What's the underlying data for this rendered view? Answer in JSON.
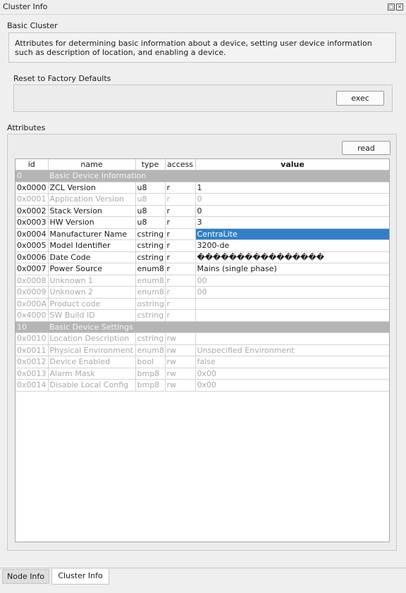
{
  "window": {
    "title": "Cluster Info"
  },
  "cluster": {
    "name": "Basic Cluster",
    "description": "Attributes for determining basic information about a device, setting user device information such as description of location, and enabling a device."
  },
  "reset": {
    "label": "Reset to Factory Defaults",
    "button": "exec"
  },
  "attributes": {
    "label": "Attributes",
    "read_button": "read",
    "columns": [
      "id",
      "name",
      "type",
      "access",
      "value"
    ],
    "rows": [
      {
        "kind": "group",
        "id": "0",
        "name": "Basic Device Information"
      },
      {
        "kind": "normal",
        "id": "0x0000",
        "name": "ZCL Version",
        "type": "u8",
        "access": "r",
        "value": "1"
      },
      {
        "kind": "disabled",
        "id": "0x0001",
        "name": "Application Version",
        "type": "u8",
        "access": "r",
        "value": "0"
      },
      {
        "kind": "normal",
        "id": "0x0002",
        "name": "Stack Version",
        "type": "u8",
        "access": "r",
        "value": "0"
      },
      {
        "kind": "normal",
        "id": "0x0003",
        "name": "HW Version",
        "type": "u8",
        "access": "r",
        "value": "3"
      },
      {
        "kind": "normal",
        "id": "0x0004",
        "name": "Manufacturer Name",
        "type": "cstring",
        "access": "r",
        "value": "CentraLite",
        "selected": true
      },
      {
        "kind": "normal",
        "id": "0x0005",
        "name": "Model Identifier",
        "type": "cstring",
        "access": "r",
        "value": "3200-de"
      },
      {
        "kind": "normal",
        "id": "0x0006",
        "name": "Date Code",
        "type": "cstring",
        "access": "r",
        "value": "����������������"
      },
      {
        "kind": "normal",
        "id": "0x0007",
        "name": "Power Source",
        "type": "enum8",
        "access": "r",
        "value": "Mains (single phase)"
      },
      {
        "kind": "disabled",
        "id": "0x0008",
        "name": "Unknown 1",
        "type": "enum8",
        "access": "r",
        "value": "00"
      },
      {
        "kind": "disabled",
        "id": "0x0009",
        "name": "Unknown 2",
        "type": "enum8",
        "access": "r",
        "value": "00"
      },
      {
        "kind": "disabled",
        "id": "0x000A",
        "name": "Product code",
        "type": "ostring",
        "access": "r",
        "value": ""
      },
      {
        "kind": "disabled",
        "id": "0x4000",
        "name": "SW Build ID",
        "type": "cstring",
        "access": "r",
        "value": ""
      },
      {
        "kind": "group",
        "id": "10",
        "name": "Basic Device Settings"
      },
      {
        "kind": "disabled",
        "id": "0x0010",
        "name": "Location Description",
        "type": "cstring",
        "access": "rw",
        "value": ""
      },
      {
        "kind": "disabled",
        "id": "0x0011",
        "name": "Physical Environment",
        "type": "enum8",
        "access": "rw",
        "value": "Unspecified Environment"
      },
      {
        "kind": "disabled",
        "id": "0x0012",
        "name": "Device Enabled",
        "type": "bool",
        "access": "rw",
        "value": "false"
      },
      {
        "kind": "disabled",
        "id": "0x0013",
        "name": "Alarm Mask",
        "type": "bmp8",
        "access": "rw",
        "value": "0x00"
      },
      {
        "kind": "disabled",
        "id": "0x0014",
        "name": "Disable Local Config",
        "type": "bmp8",
        "access": "rw",
        "value": "0x00"
      }
    ]
  },
  "tabs": [
    {
      "label": "Node Info",
      "active": false
    },
    {
      "label": "Cluster Info",
      "active": true
    }
  ],
  "colors": {
    "selection": "#2f80c8",
    "group_row": "#b5b5b5",
    "disabled_text": "#aaaaaa"
  }
}
